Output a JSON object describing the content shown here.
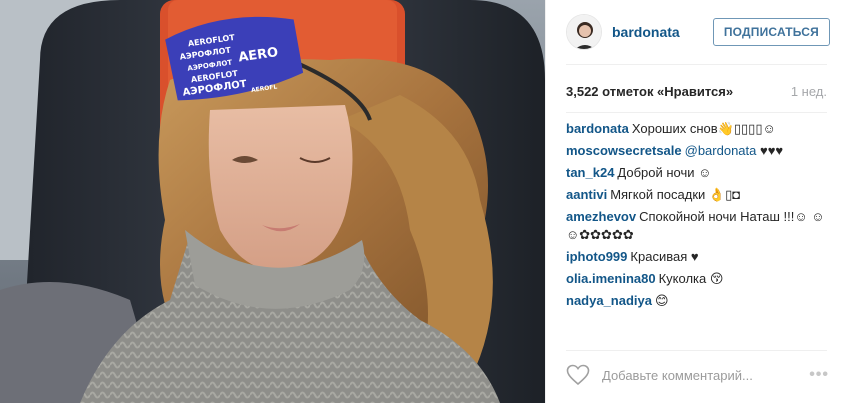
{
  "photo": {
    "mask_text": [
      "AEROFLOT",
      "АЭРОФЛОТ",
      "AERO",
      "АЭРОФЛОТ",
      "AEROFLOT",
      "АЭРОФЛОТ",
      "AEROFL"
    ]
  },
  "header": {
    "username": "bardonata",
    "follow_label": "ПОДПИСАТЬСЯ"
  },
  "stats": {
    "likes": "3,522 отметок «Нравится»",
    "time": "1 нед."
  },
  "comments": [
    {
      "author": "bardonata",
      "text": "Хороших снов👋▯▯▯▯☺",
      "mention": ""
    },
    {
      "author": "moscowsecretsale",
      "text": " ♥♥♥",
      "mention": "@bardonata"
    },
    {
      "author": "tan_k24",
      "text": "Доброй ночи ☺",
      "mention": ""
    },
    {
      "author": "aantivi",
      "text": "Мягкой посадки 👌▯◘",
      "mention": ""
    },
    {
      "author": "amezhevov",
      "text": "Спокойной ночи Наташ !!!☺ ☺☺✿✿✿✿✿",
      "mention": ""
    },
    {
      "author": "iphoto999",
      "text": "Красивая ♥",
      "mention": ""
    },
    {
      "author": "olia.imenina80",
      "text": "Куколка 😚",
      "mention": ""
    },
    {
      "author": "nadya_nadiya",
      "text": "😊",
      "mention": ""
    }
  ],
  "footer": {
    "comment_placeholder": "Добавьте комментарий...",
    "more_label": "•••"
  },
  "colors": {
    "link": "#125688",
    "follow_text": "#3f729b",
    "mask": "#3b3fb8",
    "seat_orange": "#d9502c"
  },
  "icons": {
    "like": "heart-outline-icon",
    "more": "more-options-icon"
  }
}
